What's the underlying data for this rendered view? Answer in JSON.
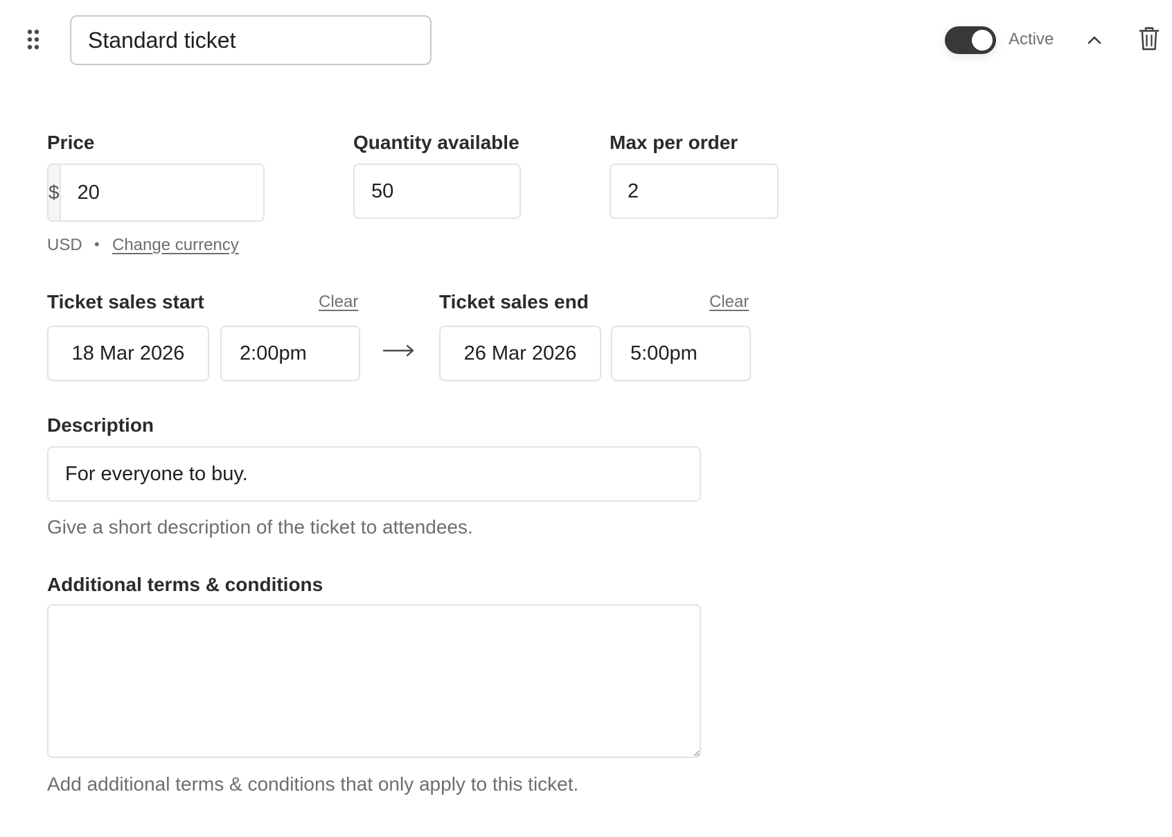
{
  "ticket": {
    "name_value": "Standard ticket",
    "status_active": true,
    "status_label": "Active"
  },
  "pricing": {
    "price_label": "Price",
    "currency_symbol": "$",
    "price_value": "20",
    "currency_code": "USD",
    "separator": "•",
    "change_currency_label": "Change currency",
    "quantity_label": "Quantity available",
    "quantity_value": "50",
    "max_per_order_label": "Max per order",
    "max_per_order_value": "2"
  },
  "sales": {
    "start_label": "Ticket sales start",
    "start_clear": "Clear",
    "start_date": "18 Mar 2026",
    "start_time": "2:00pm",
    "end_label": "Ticket sales end",
    "end_clear": "Clear",
    "end_date": "26 Mar 2026",
    "end_time": "5:00pm"
  },
  "description": {
    "label": "Description",
    "value": "For everyone to buy.",
    "help": "Give a short description of the ticket to attendees."
  },
  "terms": {
    "label": "Additional terms & conditions",
    "value": "",
    "help": "Add additional terms & conditions that only apply to this ticket."
  },
  "icons": {
    "drag": "drag-handle-icon",
    "collapse": "chevron-up-icon",
    "delete": "trash-icon",
    "arrow": "arrow-right-icon"
  },
  "colors": {
    "toggle_on": "#383838",
    "border": "#e3e3e3",
    "muted_text": "#6e6e6e"
  }
}
